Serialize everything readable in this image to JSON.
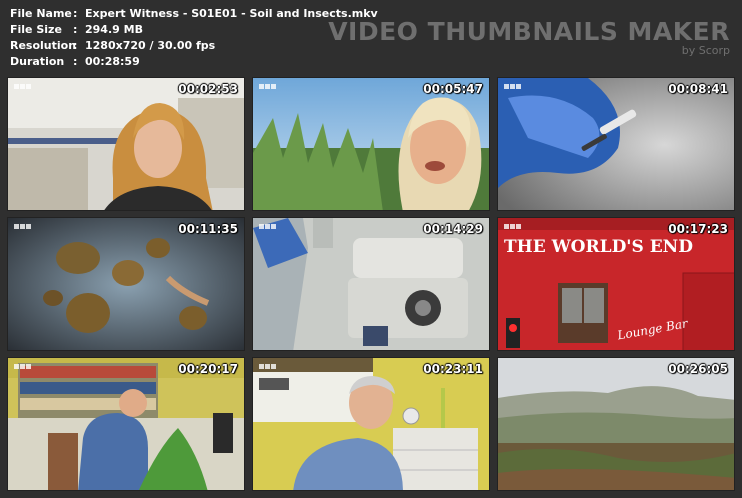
{
  "info": [
    {
      "key": "File Name",
      "value": "Expert Witness - S01E01 - Soil and Insects.mkv"
    },
    {
      "key": "File Size",
      "value": "294.9 MB"
    },
    {
      "key": "Resolution",
      "value": "1280x720 / 30.00 fps"
    },
    {
      "key": "Duration",
      "value": "00:28:59"
    }
  ],
  "separator": ":",
  "brand": {
    "title": "VIDEO THUMBNAILS MAKER",
    "subtitle": "by Scorp"
  },
  "thumbnails": [
    {
      "time": "00:02:53"
    },
    {
      "time": "00:05:47"
    },
    {
      "time": "00:08:41"
    },
    {
      "time": "00:11:35"
    },
    {
      "time": "00:14:29"
    },
    {
      "time": "00:17:23",
      "sign_text": "THE WORLD'S END",
      "sign_text2": "Lounge Bar"
    },
    {
      "time": "00:20:17"
    },
    {
      "time": "00:23:11"
    },
    {
      "time": "00:26:05"
    }
  ],
  "colors": {
    "background": "#2f2f2f",
    "text": "#ffffff",
    "brand": "#6f6f6f"
  }
}
